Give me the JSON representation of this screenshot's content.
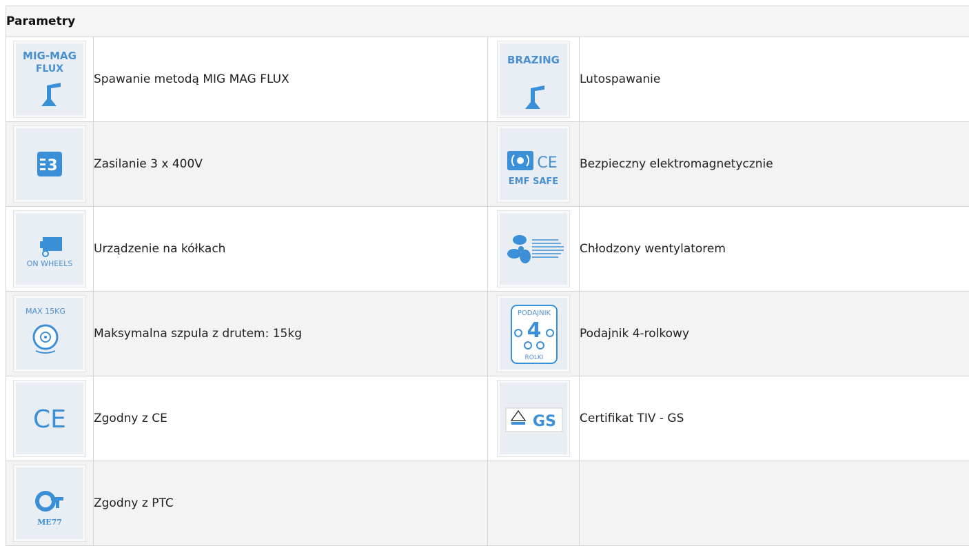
{
  "table": {
    "header": "Parametry",
    "rows": [
      [
        {
          "icon": "mig-mag-flux-icon",
          "icon_text": [
            "MIG-MAG",
            "FLUX"
          ],
          "label": "Spawanie metodą MIG MAG FLUX"
        },
        {
          "icon": "brazing-icon",
          "icon_text": [
            "BRAZING"
          ],
          "label": "Lutospawanie"
        }
      ],
      [
        {
          "icon": "three-phase-plug-icon",
          "icon_text": [
            "3"
          ],
          "label": "Zasilanie 3 x 400V"
        },
        {
          "icon": "emf-safe-icon",
          "icon_text": [
            "EMF SAFE",
            "CE"
          ],
          "label": "Bezpieczny elektromagnetycznie"
        }
      ],
      [
        {
          "icon": "on-wheels-icon",
          "icon_text": [
            "ON WHEELS"
          ],
          "label": "Urządzenie na kółkach"
        },
        {
          "icon": "fan-cooling-icon",
          "icon_text": [],
          "label": "Chłodzony wentylatorem"
        }
      ],
      [
        {
          "icon": "wire-spool-icon",
          "icon_text": [
            "MAX 15KG"
          ],
          "label": "Maksymalna szpula z drutem: 15kg"
        },
        {
          "icon": "four-roll-feeder-icon",
          "icon_text": [
            "PODAJNIK",
            "4",
            "ROLKI"
          ],
          "label": "Podajnik 4-rolkowy"
        }
      ],
      [
        {
          "icon": "ce-mark-icon",
          "icon_text": [
            "CE"
          ],
          "label": "Zgodny z CE"
        },
        {
          "icon": "tuv-gs-icon",
          "icon_text": [
            "GS"
          ],
          "label": "Certifikat TIV - GS"
        }
      ],
      [
        {
          "icon": "pct-mark-icon",
          "icon_text": [
            "ME77"
          ],
          "label": "Zgodny z PTC"
        },
        {
          "icon": "",
          "icon_text": [],
          "label": ""
        }
      ]
    ]
  },
  "colors": {
    "icon_blue": "#3b8fd6",
    "icon_text_blue": "#4a8fd0",
    "icon_bg": "#e8eef4",
    "border": "#d4d4d4",
    "row_alt": "#f3f3f3"
  }
}
